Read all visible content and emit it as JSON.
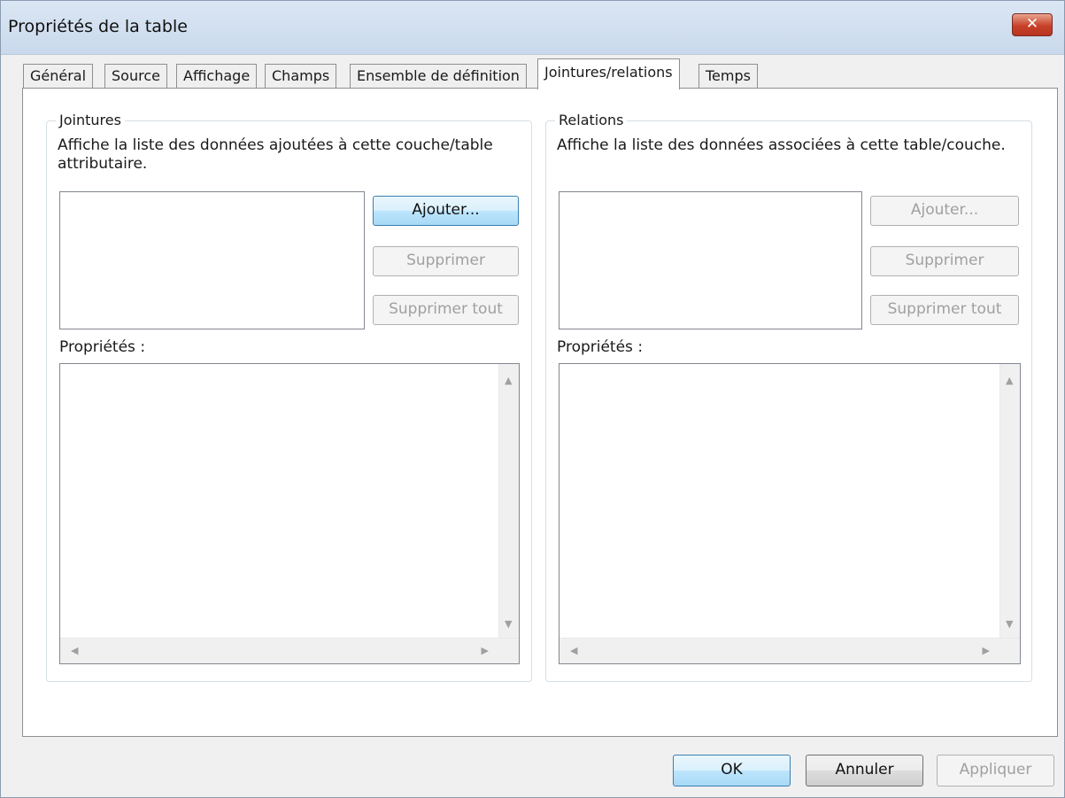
{
  "window": {
    "title": "Propriétés de la table",
    "close_glyph": "✕"
  },
  "tabs": [
    {
      "label": "Général",
      "active": false
    },
    {
      "label": "Source",
      "active": false
    },
    {
      "label": "Affichage",
      "active": false
    },
    {
      "label": "Champs",
      "active": false
    },
    {
      "label": "Ensemble de définition",
      "active": false
    },
    {
      "label": "Jointures/relations",
      "active": true
    },
    {
      "label": "Temps",
      "active": false
    }
  ],
  "joins": {
    "legend": "Jointures",
    "description": "Affiche la liste des données ajoutées à cette couche/table attributaire.",
    "add_button": "Ajouter...",
    "remove_button": "Supprimer",
    "remove_all_button": "Supprimer tout",
    "properties_label": "Propriétés :"
  },
  "relations": {
    "legend": "Relations",
    "description": "Affiche la liste des données associées à cette table/couche.",
    "add_button": "Ajouter...",
    "remove_button": "Supprimer",
    "remove_all_button": "Supprimer tout",
    "properties_label": "Propriétés :"
  },
  "footer": {
    "ok_button": "OK",
    "cancel_button": "Annuler",
    "apply_button": "Appliquer"
  }
}
